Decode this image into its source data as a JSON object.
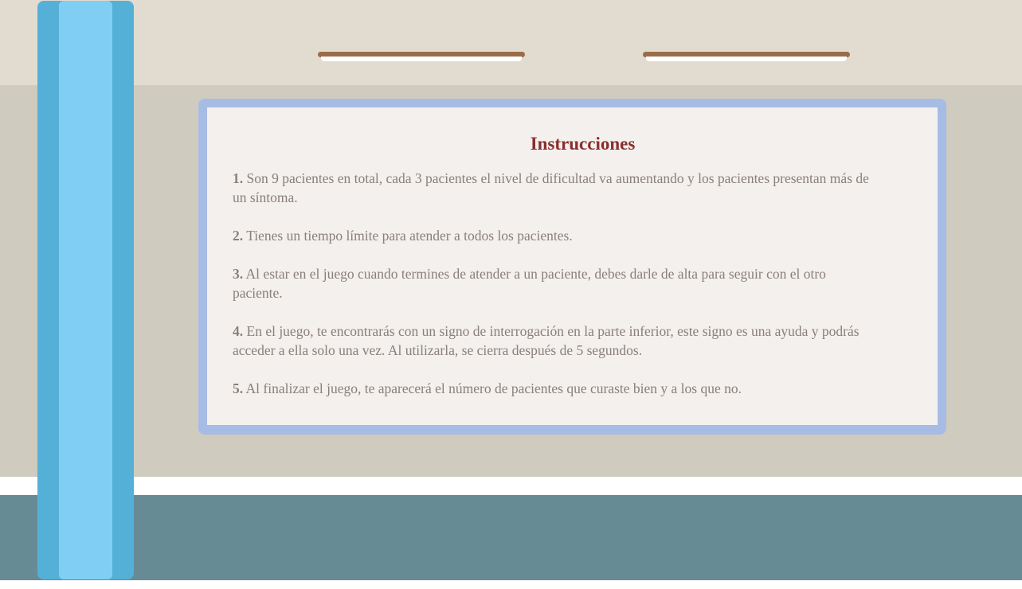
{
  "panel": {
    "title": "Instrucciones",
    "items": [
      {
        "number": "1.",
        "text": "Son 9 pacientes en total, cada 3 pacientes el nivel de dificultad va aumentando y los pacientes presentan más de un síntoma."
      },
      {
        "number": "2.",
        "text": "Tienes un tiempo límite para atender a todos los pacientes."
      },
      {
        "number": "3.",
        "text": "Al estar en el juego cuando termines de atender a un paciente, debes darle de alta para seguir con el otro paciente."
      },
      {
        "number": "4.",
        "text": "En el juego, te encontrarás con un signo de interrogación en la parte inferior, este signo es una ayuda y podrás acceder a ella solo una vez. Al utilizarla, se cierra después de 5 segundos."
      },
      {
        "number": "5.",
        "text": "Al finalizar el juego, te aparecerá el número de pacientes que curaste bien y a los que no."
      }
    ]
  },
  "colors": {
    "title": "#8b2e2e",
    "body_text": "#8a7f7a",
    "panel_border": "#a7bce5",
    "panel_bg": "#f3f0ed",
    "curtain_outer": "#55b0d8",
    "curtain_inner": "#80cef3",
    "floor": "#678b95",
    "shelf": "#9a6c4a"
  }
}
